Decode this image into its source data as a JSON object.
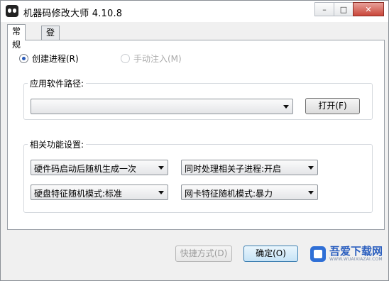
{
  "window": {
    "title": "机器码修改大师 4.10.8",
    "controls": {
      "minimize": "–",
      "maximize": "□",
      "close": "✕"
    }
  },
  "tabs": [
    {
      "label": "常规",
      "active": true
    },
    {
      "label": "登录",
      "active": false
    }
  ],
  "mode": {
    "create_process": {
      "label": "创建进程(R)",
      "checked": true
    },
    "manual_inject": {
      "label": "手动注入(M)",
      "checked": false,
      "disabled": true
    }
  },
  "app_path": {
    "group_label": "应用软件路径:",
    "value": "",
    "open_button": "打开(F)"
  },
  "features": {
    "group_label": "相关功能设置:",
    "hw_code": "硬件码启动后随机生成一次",
    "child_process": "同时处理相关子进程:开启",
    "disk_mode": "硬盘特征随机模式:标准",
    "nic_mode": "网卡特征随机模式:暴力"
  },
  "footer": {
    "shortcut_button": "快捷方式(D)",
    "ok_button": "确定(O)"
  },
  "watermark": {
    "title": "吾爱下载网",
    "subtitle": "WWW.WUAIXIAZAI.COM"
  }
}
